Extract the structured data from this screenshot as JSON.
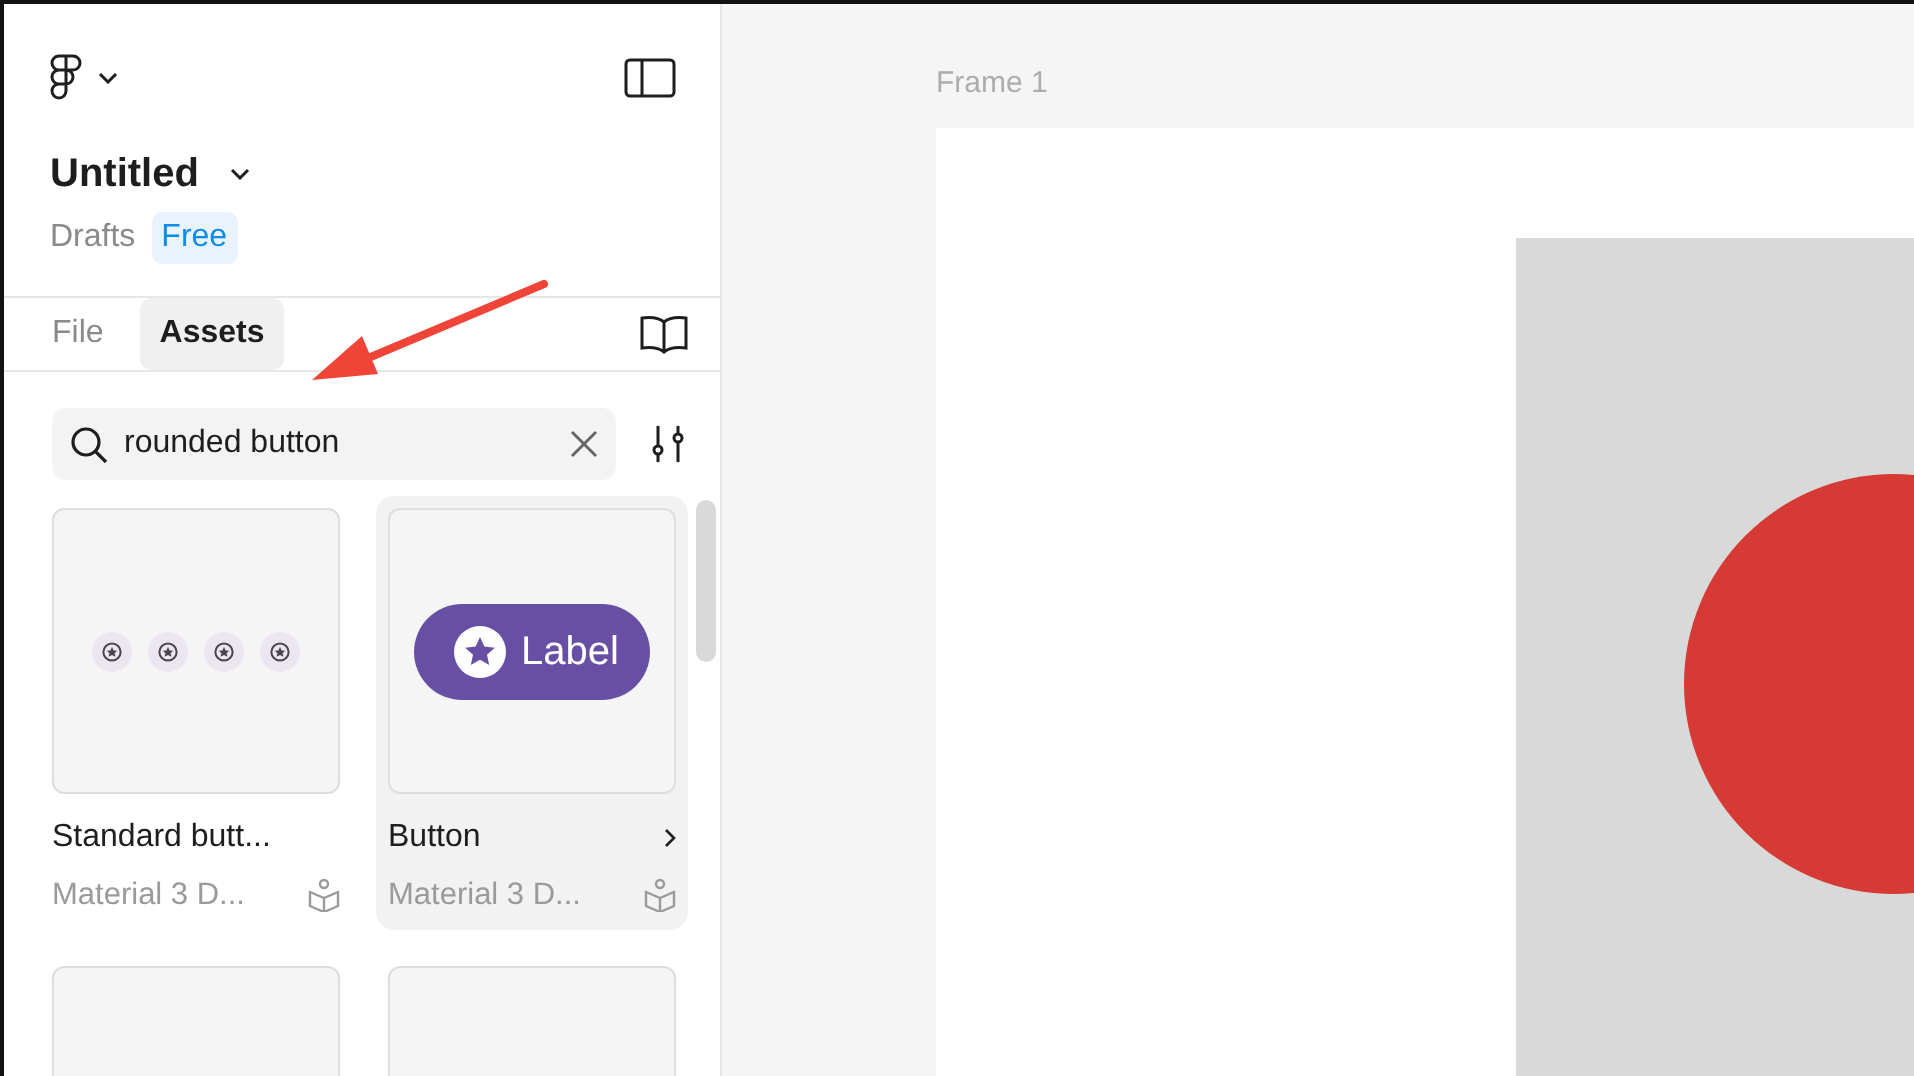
{
  "sidebar": {
    "file_title": "Untitled",
    "location": "Drafts",
    "plan_badge": "Free",
    "tabs": [
      {
        "label": "File",
        "selected": false
      },
      {
        "label": "Assets",
        "selected": true
      }
    ],
    "search": {
      "value": "rounded button"
    },
    "assets": [
      {
        "kind": "icon-row",
        "name": "Standard butt...",
        "library": "Material 3 D...",
        "hovered": false
      },
      {
        "kind": "pill",
        "name": "Button",
        "library": "Material 3 D...",
        "hovered": true,
        "preview_label": "Label"
      },
      {
        "kind": "blank"
      },
      {
        "kind": "blank"
      }
    ]
  },
  "canvas": {
    "frame_title": "Frame 1"
  }
}
